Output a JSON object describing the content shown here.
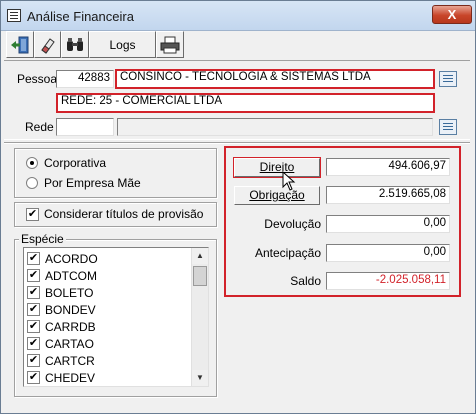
{
  "window": {
    "title": "Análise Financeira",
    "close_label": "X"
  },
  "toolbar": {
    "exit_icon": "exit-door-icon",
    "edit_icon": "eraser-icon",
    "search_icon": "binoculars-icon",
    "logs_label": "Logs",
    "print_icon": "printer-icon"
  },
  "pessoa": {
    "label": "Pessoa",
    "code": "42883",
    "name": "CONSINCO - TECNOLOGIA & SISTEMAS LTDA",
    "rede_info": "REDE: 25 - COMERCIAL LTDA"
  },
  "rede": {
    "label": "Rede",
    "code": "",
    "name": ""
  },
  "options": {
    "corporativa": "Corporativa",
    "por_empresa": "Por Empresa Mãe",
    "selected": "corporativa",
    "considerar_label": "Considerar títulos de provisão",
    "considerar_checked": true
  },
  "especie": {
    "label": "Espécie",
    "items": [
      {
        "name": "ACORDO",
        "checked": true
      },
      {
        "name": "ADTCOM",
        "checked": true
      },
      {
        "name": "BOLETO",
        "checked": true
      },
      {
        "name": "BONDEV",
        "checked": true
      },
      {
        "name": "CARRDB",
        "checked": true
      },
      {
        "name": "CARTAO",
        "checked": true
      },
      {
        "name": "CARTCR",
        "checked": true
      },
      {
        "name": "CHEDEV",
        "checked": true
      }
    ]
  },
  "resumo": {
    "direito_label": "Direito",
    "direito_value": "494.606,97",
    "obrigacao_label": "Obrigação",
    "obrigacao_value": "2.519.665,08",
    "devolucao_label": "Devolução",
    "devolucao_value": "0,00",
    "antecipacao_label": "Antecipação",
    "antecipacao_value": "0,00",
    "saldo_label": "Saldo",
    "saldo_value": "-2.025.058,11"
  },
  "colors": {
    "highlight": "#d2222a",
    "negative": "#d2222a"
  }
}
